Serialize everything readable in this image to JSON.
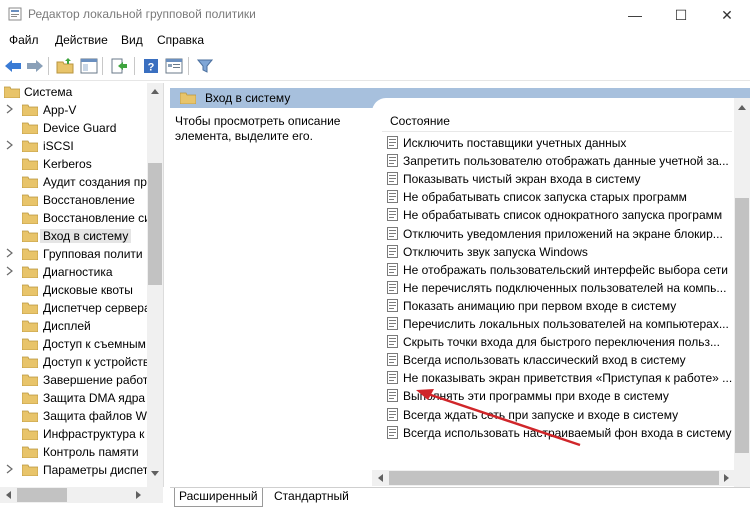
{
  "window": {
    "title": "Редактор локальной групповой политики",
    "minimize_glyph": "—",
    "maximize_glyph": "☐",
    "close_glyph": "✕"
  },
  "menu": {
    "items": [
      {
        "label": "Файл"
      },
      {
        "label": "Действие"
      },
      {
        "label": "Вид"
      },
      {
        "label": "Справка"
      }
    ]
  },
  "tree": {
    "items": [
      {
        "label": "Система",
        "expandable": false,
        "top": true
      },
      {
        "label": "App-V",
        "expandable": true
      },
      {
        "label": "Device Guard",
        "expandable": false
      },
      {
        "label": "iSCSI",
        "expandable": true
      },
      {
        "label": "Kerberos",
        "expandable": false
      },
      {
        "label": "Аудит создания пр",
        "expandable": false
      },
      {
        "label": "Восстановление",
        "expandable": false
      },
      {
        "label": "Восстановление си",
        "expandable": false
      },
      {
        "label": "Вход в систему",
        "expandable": false,
        "selected": true
      },
      {
        "label": "Групповая полити",
        "expandable": true
      },
      {
        "label": "Диагностика",
        "expandable": true
      },
      {
        "label": "Дисковые квоты",
        "expandable": false
      },
      {
        "label": "Диспетчер сервера",
        "expandable": false
      },
      {
        "label": "Дисплей",
        "expandable": false
      },
      {
        "label": "Доступ к съемным",
        "expandable": false
      },
      {
        "label": "Доступ к устройств",
        "expandable": false
      },
      {
        "label": "Завершение работ",
        "expandable": false
      },
      {
        "label": "Защита DMA ядра",
        "expandable": false
      },
      {
        "label": "Защита файлов Wi",
        "expandable": false
      },
      {
        "label": "Инфраструктура к",
        "expandable": false
      },
      {
        "label": "Контроль памяти",
        "expandable": false
      },
      {
        "label": "Параметры диспет",
        "expandable": true
      }
    ]
  },
  "pane": {
    "header": "Вход в систему",
    "description": "Чтобы просмотреть описание элемента, выделите его.",
    "column_header": "Состояние",
    "items": [
      "Исключить поставщики учетных данных",
      "Запретить пользователю отображать данные учетной за...",
      "Показывать чистый экран входа в систему",
      "Не обрабатывать список запуска старых программ",
      "Не обрабатывать список однократного запуска программ",
      "Отключить уведомления приложений на экране блокир...",
      "Отключить звук запуска Windows",
      "Не отображать пользовательский интерфейс выбора сети",
      "Не перечислять подключенных пользователей на компь...",
      "Показать анимацию при первом входе в систему",
      "Перечислить локальных пользователей на компьютерах...",
      "Скрыть точки входа для быстрого переключения польз...",
      "Всегда использовать классический вход в систему",
      "Не показывать экран приветствия «Приступая к работе» ...",
      "Выполнять эти программы при входе в систему",
      "Всегда ждать сеть при запуске и входе в систему",
      "Всегда использовать настраиваемый фон входа в систему"
    ]
  },
  "tabs": [
    {
      "label": "Расширенный",
      "active": true
    },
    {
      "label": "Стандартный",
      "active": false
    }
  ],
  "colors": {
    "header_bg": "#a7c0dd",
    "folder": "#e8c46a",
    "arrow": "#d0262a",
    "selection": "#e5e5e5"
  }
}
